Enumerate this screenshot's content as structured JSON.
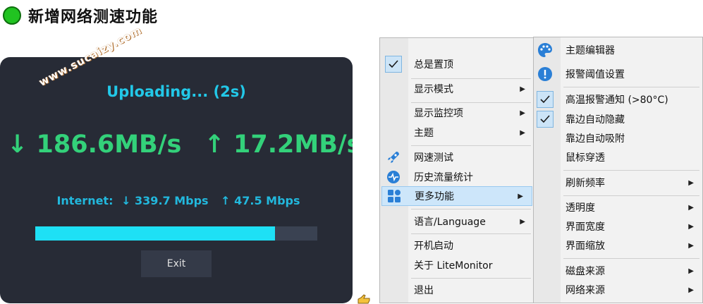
{
  "heading": {
    "title": "新增网络测速功能",
    "dot_color": "#21c321"
  },
  "panel": {
    "watermark": "www.sucaizy.com",
    "status": "Uploading... (2s)",
    "download": "↓ 186.6MB/s",
    "upload": "↑ 17.2MB/s",
    "internet_label": "Internet:",
    "internet_down": "↓ 339.7 Mbps",
    "internet_up": "↑ 47.5 Mbps",
    "progress": 0.85,
    "exit_label": "Exit"
  },
  "menu_left": {
    "items": [
      {
        "label": "总是置顶",
        "checked": true
      },
      {
        "label": "显示模式",
        "submenu": true
      },
      {
        "label": "显示监控项",
        "submenu": true
      },
      {
        "label": "主题",
        "submenu": true
      },
      {
        "label": "网速测试",
        "icon": "rocket-icon"
      },
      {
        "label": "历史流量统计",
        "icon": "pulse-icon"
      },
      {
        "label": "更多功能",
        "icon": "apps-icon",
        "submenu": true,
        "highlighted": true
      },
      {
        "label": "语言/Language",
        "submenu": true
      },
      {
        "label": "开机启动"
      },
      {
        "label": "关于 LiteMonitor"
      },
      {
        "label": "退出"
      }
    ]
  },
  "menu_right": {
    "items": [
      {
        "label": "主题编辑器",
        "icon": "palette-icon"
      },
      {
        "label": "报警阈值设置",
        "icon": "alert-icon"
      },
      {
        "label": "高温报警通知 (>80°C)",
        "checked": true
      },
      {
        "label": "靠边自动隐藏",
        "checked": true
      },
      {
        "label": "靠边自动吸附"
      },
      {
        "label": "鼠标穿透"
      },
      {
        "label": "刷新频率",
        "submenu": true
      },
      {
        "label": "透明度",
        "submenu": true
      },
      {
        "label": "界面宽度",
        "submenu": true
      },
      {
        "label": "界面缩放",
        "submenu": true
      },
      {
        "label": "磁盘来源",
        "submenu": true
      },
      {
        "label": "网络来源",
        "submenu": true
      }
    ]
  },
  "colors": {
    "accent": "#22c8e8",
    "speed": "#33d17a",
    "panel_bg": "#272b36",
    "menu_highlight": "#cde6fa"
  }
}
